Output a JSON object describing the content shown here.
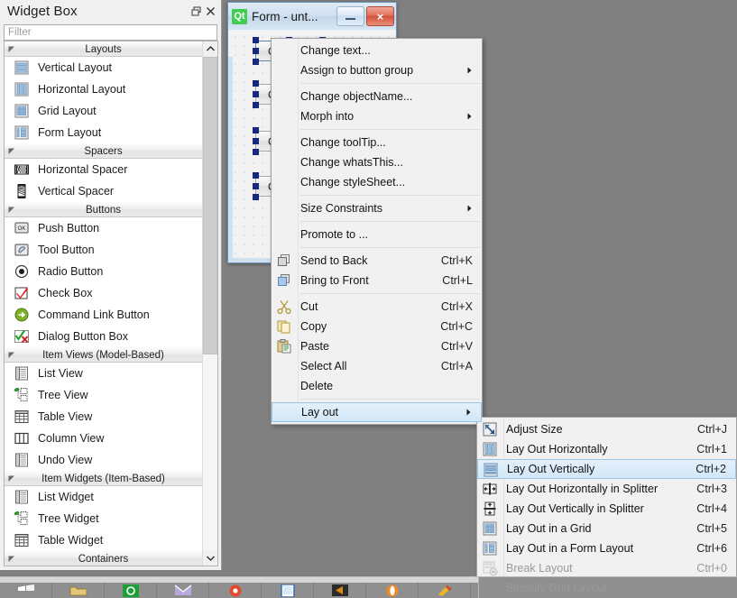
{
  "widget_box": {
    "title": "Widget Box",
    "float_button": "restore-icon",
    "close_button": "close-icon",
    "filter": {
      "value": "",
      "placeholder": "Filter"
    },
    "categories": [
      {
        "label": "Layouts",
        "items": [
          {
            "label": "Vertical Layout",
            "icon": "vertical-layout-icon"
          },
          {
            "label": "Horizontal Layout",
            "icon": "horizontal-layout-icon"
          },
          {
            "label": "Grid Layout",
            "icon": "grid-layout-icon"
          },
          {
            "label": "Form Layout",
            "icon": "form-layout-icon"
          }
        ]
      },
      {
        "label": "Spacers",
        "items": [
          {
            "label": "Horizontal Spacer",
            "icon": "horizontal-spacer-icon"
          },
          {
            "label": "Vertical Spacer",
            "icon": "vertical-spacer-icon"
          }
        ]
      },
      {
        "label": "Buttons",
        "items": [
          {
            "label": "Push Button",
            "icon": "push-button-icon"
          },
          {
            "label": "Tool Button",
            "icon": "tool-button-icon"
          },
          {
            "label": "Radio Button",
            "icon": "radio-button-icon"
          },
          {
            "label": "Check Box",
            "icon": "check-box-icon"
          },
          {
            "label": "Command Link Button",
            "icon": "command-link-icon"
          },
          {
            "label": "Dialog Button Box",
            "icon": "dialog-button-box-icon"
          }
        ]
      },
      {
        "label": "Item Views (Model-Based)",
        "items": [
          {
            "label": "List View",
            "icon": "list-view-icon"
          },
          {
            "label": "Tree View",
            "icon": "tree-view-icon"
          },
          {
            "label": "Table View",
            "icon": "table-view-icon"
          },
          {
            "label": "Column View",
            "icon": "column-view-icon"
          },
          {
            "label": "Undo View",
            "icon": "undo-view-icon"
          }
        ]
      },
      {
        "label": "Item Widgets (Item-Based)",
        "items": [
          {
            "label": "List Widget",
            "icon": "list-widget-icon"
          },
          {
            "label": "Tree Widget",
            "icon": "tree-widget-icon"
          },
          {
            "label": "Table Widget",
            "icon": "table-widget-icon"
          }
        ]
      },
      {
        "label": "Containers",
        "items": []
      }
    ]
  },
  "form_window": {
    "title": "Form - unt...",
    "logo_text": "Qt",
    "minimize_label": "minimize-icon",
    "close_label": "×",
    "widgets": [
      {
        "label": "Click Me",
        "selected": true
      },
      {
        "label": "Click Me",
        "selected": false
      },
      {
        "label": "Click Me",
        "selected": false
      },
      {
        "label": "Click Me",
        "selected": false
      }
    ]
  },
  "context_menu": {
    "items": [
      {
        "label": "Change text...",
        "shortcut": "",
        "icon": "",
        "submenu": false,
        "separator_after": false
      },
      {
        "label": "Assign to button group",
        "shortcut": "",
        "icon": "",
        "submenu": true,
        "separator_after": true
      },
      {
        "label": "Change objectName...",
        "shortcut": "",
        "icon": "",
        "submenu": false,
        "separator_after": false
      },
      {
        "label": "Morph into",
        "shortcut": "",
        "icon": "",
        "submenu": true,
        "separator_after": true
      },
      {
        "label": "Change toolTip...",
        "shortcut": "",
        "icon": "",
        "submenu": false,
        "separator_after": false
      },
      {
        "label": "Change whatsThis...",
        "shortcut": "",
        "icon": "",
        "submenu": false,
        "separator_after": false
      },
      {
        "label": "Change styleSheet...",
        "shortcut": "",
        "icon": "",
        "submenu": false,
        "separator_after": true
      },
      {
        "label": "Size Constraints",
        "shortcut": "",
        "icon": "",
        "submenu": true,
        "separator_after": true
      },
      {
        "label": "Promote to ...",
        "shortcut": "",
        "icon": "",
        "submenu": false,
        "separator_after": true
      },
      {
        "label": "Send to Back",
        "shortcut": "Ctrl+K",
        "icon": "send-to-back-icon",
        "submenu": false,
        "separator_after": false
      },
      {
        "label": "Bring to Front",
        "shortcut": "Ctrl+L",
        "icon": "bring-to-front-icon",
        "submenu": false,
        "separator_after": true
      },
      {
        "label": "Cut",
        "shortcut": "Ctrl+X",
        "icon": "cut-icon",
        "submenu": false,
        "separator_after": false
      },
      {
        "label": "Copy",
        "shortcut": "Ctrl+C",
        "icon": "copy-icon",
        "submenu": false,
        "separator_after": false
      },
      {
        "label": "Paste",
        "shortcut": "Ctrl+V",
        "icon": "paste-icon",
        "submenu": false,
        "separator_after": false
      },
      {
        "label": "Select All",
        "shortcut": "Ctrl+A",
        "icon": "",
        "submenu": false,
        "separator_after": false
      },
      {
        "label": "Delete",
        "shortcut": "",
        "icon": "",
        "submenu": false,
        "separator_after": true
      },
      {
        "label": "Lay out",
        "shortcut": "",
        "icon": "",
        "submenu": true,
        "highlighted": true,
        "separator_after": false
      }
    ]
  },
  "layout_submenu": {
    "items": [
      {
        "label": "Adjust Size",
        "shortcut": "Ctrl+J",
        "icon": "adjust-size-icon",
        "highlighted": false,
        "disabled": false
      },
      {
        "label": "Lay Out Horizontally",
        "shortcut": "Ctrl+1",
        "icon": "lay-out-horizontally-icon",
        "highlighted": false,
        "disabled": false
      },
      {
        "label": "Lay Out Vertically",
        "shortcut": "Ctrl+2",
        "icon": "lay-out-vertically-icon",
        "highlighted": true,
        "disabled": false
      },
      {
        "label": "Lay Out Horizontally in Splitter",
        "shortcut": "Ctrl+3",
        "icon": "splitter-horizontal-icon",
        "highlighted": false,
        "disabled": false
      },
      {
        "label": "Lay Out Vertically in Splitter",
        "shortcut": "Ctrl+4",
        "icon": "splitter-vertical-icon",
        "highlighted": false,
        "disabled": false
      },
      {
        "label": "Lay Out in a Grid",
        "shortcut": "Ctrl+5",
        "icon": "grid-layout-icon",
        "highlighted": false,
        "disabled": false
      },
      {
        "label": "Lay Out in a Form Layout",
        "shortcut": "Ctrl+6",
        "icon": "form-layout-icon",
        "highlighted": false,
        "disabled": false
      },
      {
        "label": "Break Layout",
        "shortcut": "Ctrl+0",
        "icon": "break-layout-icon",
        "highlighted": false,
        "disabled": true
      },
      {
        "label": "Simplify Grid Layout",
        "shortcut": "",
        "icon": "",
        "highlighted": false,
        "disabled": true
      }
    ]
  },
  "taskbar": {
    "items": [
      {
        "name": "start-button",
        "color": "#ffffff"
      },
      {
        "name": "file-explorer-icon",
        "color": "#e6c77a"
      },
      {
        "name": "green-app-icon",
        "color": "#1f9e3a"
      },
      {
        "name": "mail-app-icon",
        "color": "#b9a8e0"
      },
      {
        "name": "browser-app-icon",
        "color": "#e24a2b"
      },
      {
        "name": "document-app-icon",
        "color": "#2f6fb5"
      },
      {
        "name": "media-app-icon",
        "color": "#d98b16"
      },
      {
        "name": "opera-app-icon",
        "color": "#f08a24"
      },
      {
        "name": "paint-app-icon",
        "color": "#f0b429"
      }
    ]
  },
  "colors": {
    "menu_bg": "#f1f1f1",
    "highlight": "#d2e7f8",
    "highlight_border": "#9cc4e4",
    "desktop": "#808080",
    "panel_bg": "#f0f0f0",
    "qt_green": "#41cd52",
    "selection_handle": "#14287d"
  }
}
